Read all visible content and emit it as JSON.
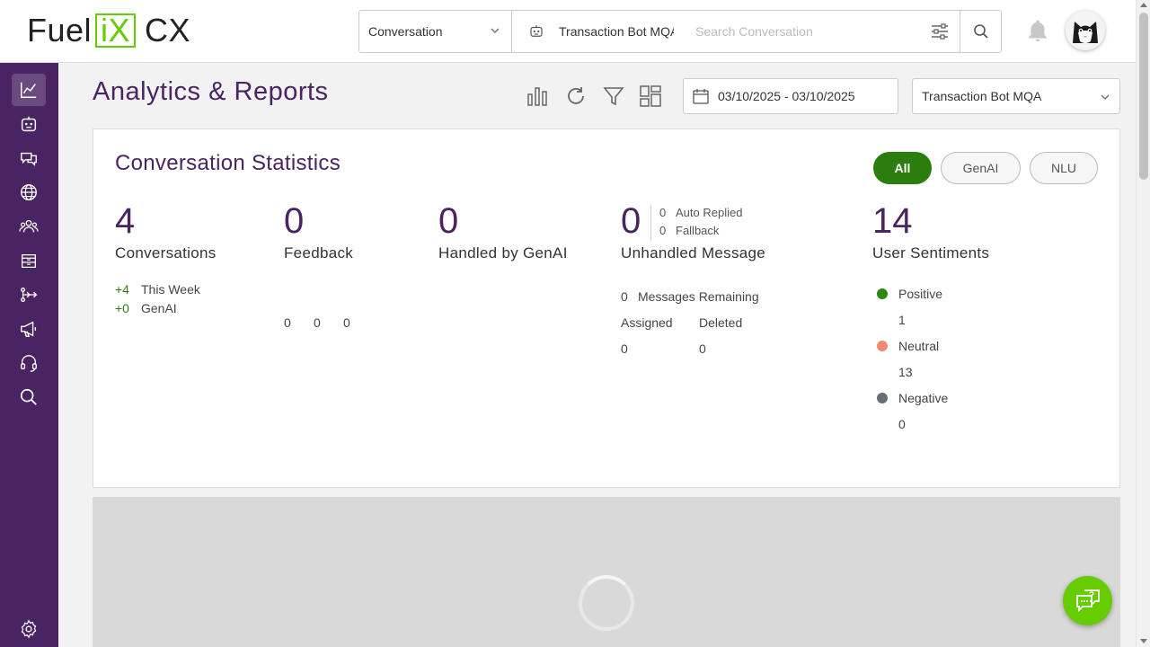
{
  "brand": {
    "logo_fuel": "Fuel",
    "logo_ix": "iX",
    "logo_cx": "CX",
    "accent": "#66cc00",
    "primary": "#4a2462"
  },
  "header": {
    "search_type": "Conversation",
    "bot_name": "Transaction Bot MQA",
    "search_placeholder": "Search Conversation"
  },
  "sidebar": {
    "items": [
      {
        "icon": "analytics-icon",
        "active": true
      },
      {
        "icon": "bot-icon"
      },
      {
        "icon": "intents-icon"
      },
      {
        "icon": "globe-icon"
      },
      {
        "icon": "users-icon"
      },
      {
        "icon": "knowledge-base-icon"
      },
      {
        "icon": "flow-icon"
      },
      {
        "icon": "campaign-icon"
      },
      {
        "icon": "support-icon"
      },
      {
        "icon": "search-icon"
      },
      {
        "icon": "settings-icon"
      }
    ]
  },
  "page": {
    "title": "Analytics & Reports",
    "date_range": "03/10/2025 - 03/10/2025",
    "bot_select": "Transaction Bot MQA"
  },
  "stats": {
    "title": "Conversation Statistics",
    "filters": [
      "All",
      "GenAI",
      "NLU"
    ],
    "conversations": {
      "value": "4",
      "label": "Conversations",
      "week_delta": "+4",
      "week_label": "This Week",
      "genai_delta": "+0",
      "genai_label": "GenAI"
    },
    "feedback": {
      "value": "0",
      "label": "Feedback",
      "a": "0",
      "b": "0",
      "c": "0"
    },
    "genai": {
      "value": "0",
      "label": "Handled by GenAI"
    },
    "unhandled": {
      "value": "0",
      "label": "Unhandled Message",
      "auto_replied_value": "0",
      "auto_replied_label": "Auto Replied",
      "fallback_value": "0",
      "fallback_label": "Fallback",
      "remaining_value": "0",
      "remaining_label": "Messages Remaining",
      "assigned_label": "Assigned",
      "assigned_value": "0",
      "deleted_label": "Deleted",
      "deleted_value": "0"
    },
    "sentiment": {
      "value": "14",
      "label": "User Sentiments",
      "positive_label": "Positive",
      "positive_value": "1",
      "positive_color": "#2b8a0e",
      "neutral_label": "Neutral",
      "neutral_value": "13",
      "neutral_color": "#f28b6d",
      "negative_label": "Negative",
      "negative_value": "0",
      "negative_color": "#666d75"
    }
  }
}
